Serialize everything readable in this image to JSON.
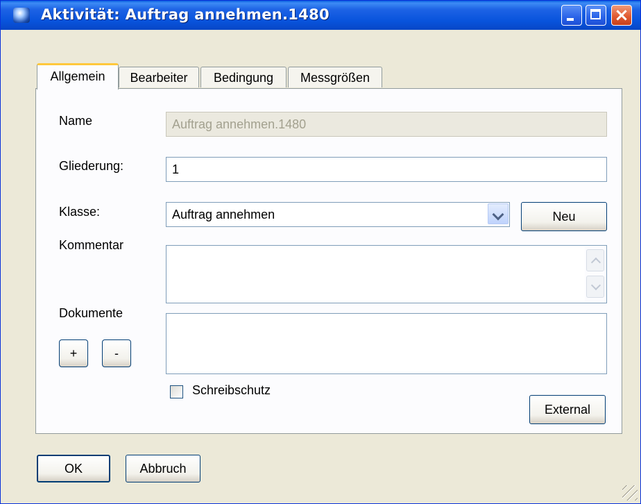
{
  "window": {
    "title": "Aktivität: Auftrag annehmen.1480",
    "icon": "app-globe-icon",
    "controls": {
      "minimize": "minimize-icon",
      "maximize": "maximize-icon",
      "close": "close-icon"
    }
  },
  "tabs": [
    {
      "label": "Allgemein",
      "active": true
    },
    {
      "label": "Bearbeiter",
      "active": false
    },
    {
      "label": "Bedingung",
      "active": false
    },
    {
      "label": "Messgrößen",
      "active": false
    }
  ],
  "form": {
    "name_label": "Name",
    "name_value": "Auftrag annehmen.1480",
    "gliederung_label": "Gliederung:",
    "gliederung_value": "1",
    "klasse_label": "Klasse:",
    "klasse_value": "Auftrag annehmen",
    "neu_button": "Neu",
    "kommentar_label": "Kommentar",
    "kommentar_value": "",
    "dokumente_label": "Dokumente",
    "add_button": "+",
    "remove_button": "-",
    "schreibschutz_label": "Schreibschutz",
    "schreibschutz_checked": false,
    "external_button": "External"
  },
  "footer": {
    "ok_button": "OK",
    "cancel_button": "Abbruch"
  },
  "colors": {
    "title_bar": "#0853dc",
    "dialog_bg": "#ece9d8",
    "active_tab_accent": "#ffc83c",
    "close_button": "#e15b32"
  }
}
